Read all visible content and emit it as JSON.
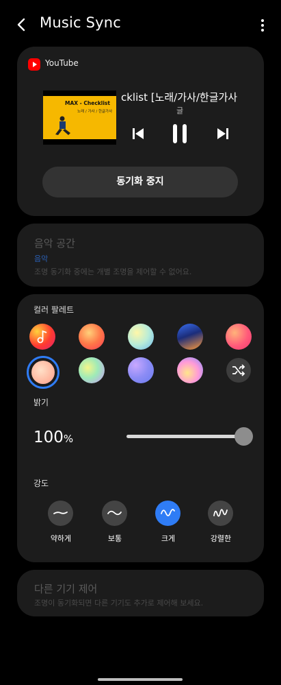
{
  "header": {
    "title": "Music Sync",
    "back_icon": "chevron-left-icon",
    "more_icon": "more-vertical-icon"
  },
  "player": {
    "source": "YouTube",
    "thumbnail_title": "MAX - Checklist",
    "thumbnail_subtitle": "노래 / 가사 / 한글가사",
    "song_title": "cklist [노래/가사/한글가사",
    "artist": "글",
    "sync_button": "동기화 중지"
  },
  "music_space": {
    "title": "음악 공간",
    "value": "음악",
    "note": "조명 동기화 중에는 개별 조명을 제어할 수 없어요."
  },
  "palette": {
    "label": "컬러 팔레트",
    "selected_index": 5,
    "shuffle_icon": "shuffle-icon"
  },
  "brightness": {
    "label": "밝기",
    "value": "100",
    "unit": "%",
    "level": 1.0
  },
  "intensity": {
    "label": "강도",
    "options": [
      "약하게",
      "보통",
      "크게",
      "강렬한"
    ],
    "selected": "크게"
  },
  "other_devices": {
    "title": "다른 기기 제어",
    "note": "조명이 동기화되면 다른 기기도 추가로 제어해 보세요."
  },
  "colors": {
    "card": "#1c1c1c",
    "accent": "#2f7cf5",
    "link": "#2f7cf5",
    "dim_text": "#5a5a5a"
  }
}
